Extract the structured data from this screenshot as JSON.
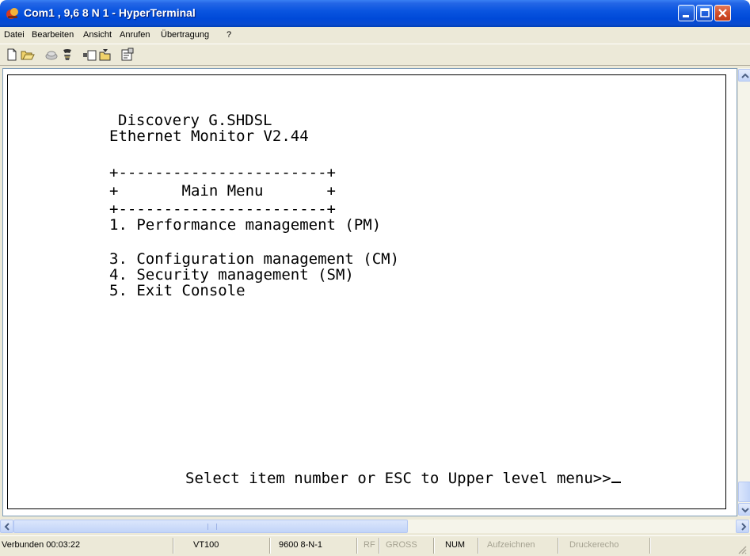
{
  "window": {
    "title": "Com1 , 9,6 8 N 1 - HyperTerminal"
  },
  "menu": [
    "Datei",
    "Bearbeiten",
    "Ansicht",
    "Anrufen",
    "Übertragung",
    "?"
  ],
  "terminal": {
    "header1": "Discovery G.SHDSL",
    "header2": "Ethernet Monitor V2.44",
    "border_top": "+-----------------------+",
    "menu_title": "+       Main Menu       +",
    "border_bottom": "+-----------------------+",
    "item1": "1. Performance management (PM)",
    "item3": "3. Configuration management (CM)",
    "item4": "4. Security management (SM)",
    "item5": "5. Exit Console",
    "prompt": "Select item number or ESC to Upper level menu>>"
  },
  "status": {
    "connected": "Verbunden 00:03:22",
    "emulation": "VT100",
    "settings": "9600 8-N-1",
    "rf": "RF",
    "caps": "GROSS",
    "num": "NUM",
    "capture": "Aufzeichnen",
    "print_echo": "Druckerecho"
  },
  "icons": [
    "app-icon",
    "minimize-icon",
    "maximize-icon",
    "close-icon",
    "new-icon",
    "open-icon",
    "disconnect-icon",
    "connect-icon",
    "send-icon",
    "receive-icon",
    "properties-icon"
  ],
  "colors": {
    "titlebar": "#0a55e0",
    "chrome": "#ece9d8",
    "terminal_bg": "#ffffff"
  }
}
